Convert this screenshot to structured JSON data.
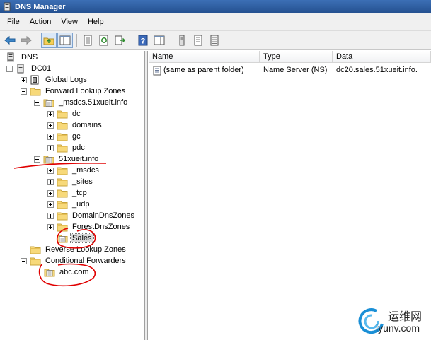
{
  "window": {
    "title": "DNS Manager"
  },
  "menu": [
    "File",
    "Action",
    "View",
    "Help"
  ],
  "toolbar": {
    "buttons": [
      "back-icon",
      "forward-icon",
      "up-folder-icon",
      "show-hide-tree-icon",
      "properties-icon",
      "refresh-icon",
      "export-list-icon",
      "help-icon",
      "show-console-tree-icon",
      "update-server-file-icon",
      "new-record-icon",
      "new-zone-icon"
    ]
  },
  "tree": {
    "root": "DNS",
    "server": "DC01",
    "global_logs": "Global Logs",
    "forward_zones": "Forward Lookup Zones",
    "msdcs_zone": "_msdcs.51xueit.info",
    "msdcs_children": [
      "dc",
      "domains",
      "gc",
      "pdc"
    ],
    "main_zone": "51xueit.info",
    "main_children": [
      "_msdcs",
      "_sites",
      "_tcp",
      "_udp",
      "DomainDnsZones",
      "ForestDnsZones"
    ],
    "sales": "Sales",
    "reverse_zones": "Reverse Lookup Zones",
    "conditional_forwarders": "Conditional Forwarders",
    "forwarder": "abc.com"
  },
  "list": {
    "columns": [
      "Name",
      "Type",
      "Data"
    ],
    "rows": [
      {
        "name": "(same as parent folder)",
        "type": "Name Server (NS)",
        "data": "dc20.sales.51xueit.info."
      }
    ]
  },
  "watermark": {
    "text_cn": "运维网",
    "url": "iyunv.com"
  },
  "colors": {
    "title_bar": "#2d5fa3",
    "annotation": "#e00000",
    "folder": "#f3d070"
  }
}
